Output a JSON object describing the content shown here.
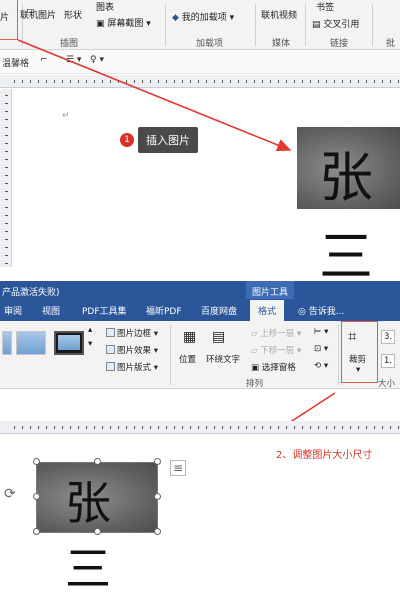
{
  "ribbon1": {
    "buttons": {
      "online_picture": "联机图片",
      "shapes": "形状",
      "icons": "图表",
      "screenshot": "屏幕截图",
      "my_addins": "我的加载项",
      "online_video": "联机视频",
      "bookmark": "书签",
      "cross_ref": "交叉引用"
    },
    "groups": {
      "illustrations": "插图",
      "addins": "加载项",
      "media": "媒体",
      "links": "链接",
      "comments": "批"
    },
    "left_partial": "片",
    "qat_text": "温馨格"
  },
  "step1": {
    "badge": "1",
    "label": "插入图片"
  },
  "window2": {
    "title_partial": "产品激活失败)",
    "tool_context": "图片工具",
    "tabs": [
      "审阅",
      "视图",
      "PDF工具集",
      "福昕PDF",
      "百度网盘",
      "格式"
    ],
    "active_tab": "格式",
    "tell_me": "告诉我...",
    "picture_styles": {
      "border": "图片边框",
      "effects": "图片效果",
      "layout": "图片版式"
    },
    "arrange": {
      "position": "位置",
      "wrap_text": "环绕文字",
      "bring_forward": "上移一层",
      "send_backward": "下移一层",
      "selection_pane": "选择窗格",
      "group_label": "排列"
    },
    "size": {
      "crop": "裁剪",
      "height_partial": "3.",
      "width_partial": "1.",
      "group_label": "大小"
    }
  },
  "step2": {
    "label": "2、调整图片大小尺寸"
  },
  "handwriting": "张 三",
  "colors": {
    "accent_blue": "#2b579a",
    "annotation_red": "#d9312a"
  }
}
